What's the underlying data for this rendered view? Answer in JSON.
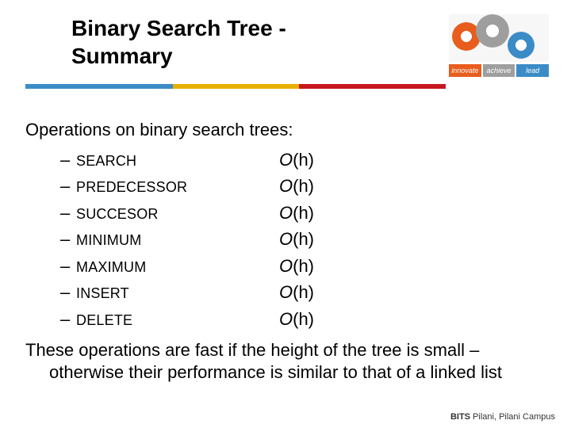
{
  "title": "Binary Search Tree - Summary",
  "logo_tags": [
    "innovate",
    "achieve",
    "lead"
  ],
  "intro": "Operations on binary search trees:",
  "operations": [
    {
      "name": "SEARCH",
      "complexity": "O(h)"
    },
    {
      "name": "PREDECESSOR",
      "complexity": "O(h)"
    },
    {
      "name": "SUCCESOR",
      "complexity": "O(h)"
    },
    {
      "name": "MINIMUM",
      "complexity": "O(h)"
    },
    {
      "name": "MAXIMUM",
      "complexity": "O(h)"
    },
    {
      "name": "INSERT",
      "complexity": "O(h)"
    },
    {
      "name": "DELETE",
      "complexity": "O(h)"
    }
  ],
  "closing": "These operations are fast if the height of the tree is small – otherwise their performance is similar to that of a linked list",
  "footer_bold": "BITS",
  "footer_rest": " Pilani, Pilani Campus"
}
